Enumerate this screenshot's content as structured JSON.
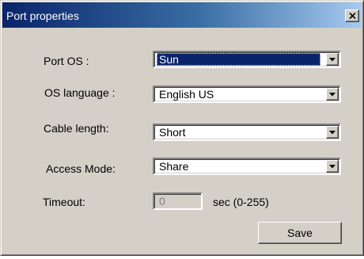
{
  "window": {
    "title": "Port properties"
  },
  "fields": {
    "port_os": {
      "label": "Port OS :",
      "value": "Sun"
    },
    "os_language": {
      "label": "OS language :",
      "value": "English US"
    },
    "cable_length": {
      "label": "Cable length:",
      "value": "Short"
    },
    "access_mode": {
      "label": "Access Mode:",
      "value": "Share"
    },
    "timeout": {
      "label": "Timeout:",
      "value": "0",
      "unit": "sec (0-255)"
    }
  },
  "buttons": {
    "save_label": "Save"
  },
  "icons": {
    "close": "close-icon",
    "dropdown": "chevron-down-icon"
  },
  "colors": {
    "title_bar_start": "#0a246a",
    "title_bar_end": "#a6caf0",
    "dialog_face": "#d4d0c8",
    "selection": "#0a246a"
  }
}
